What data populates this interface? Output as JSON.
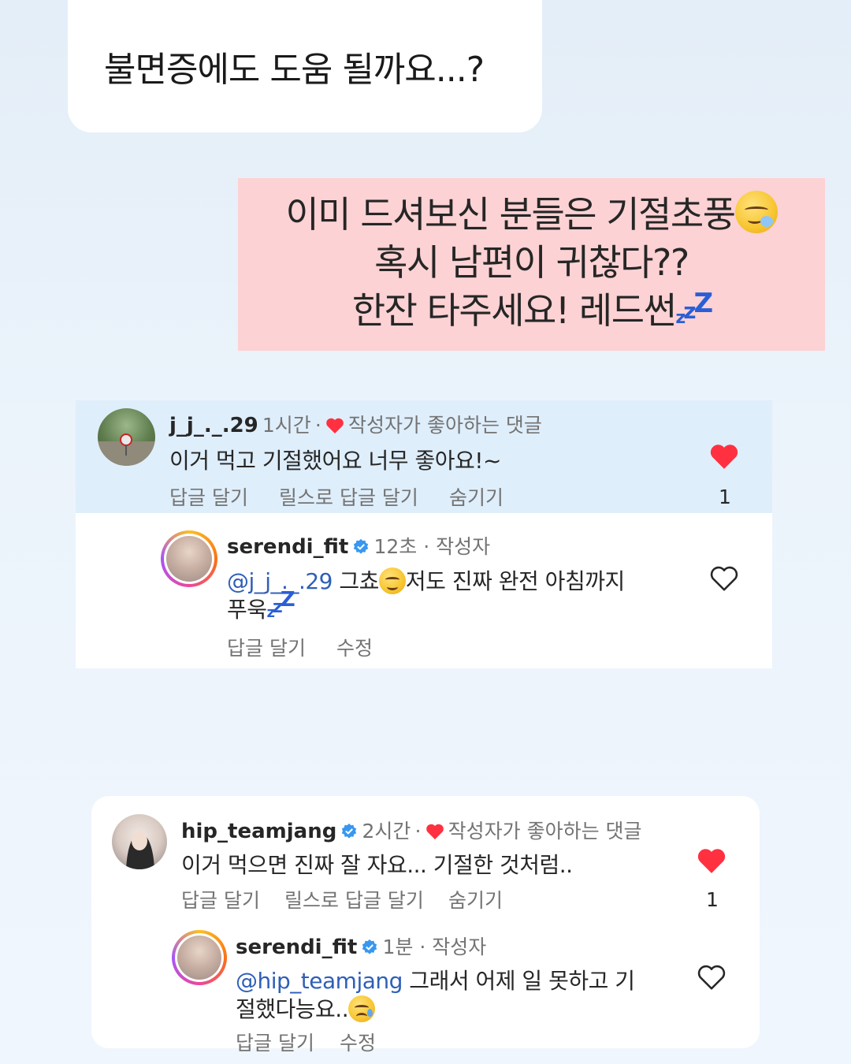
{
  "question": {
    "text": "불면증에도 도움 될까요...?"
  },
  "answer": {
    "line1": "이미 드셔보신 분들은 기절초풍",
    "line1_emoji": "sleepy-face",
    "line2": "혹시 남편이 귀찮다??",
    "line3": "한잔 타주세요! 레드썬",
    "zzz": [
      "z",
      "z",
      "Z"
    ]
  },
  "comments": [
    {
      "username": "j_j_._.29",
      "time": "1시간",
      "dot": "·",
      "liked_label": "작성자가 좋아하는 댓글",
      "text": "이거 먹고 기절했어요 너무 좋아요!~",
      "actions": [
        "답글 달기",
        "릴스로 답글 달기",
        "숨기기"
      ],
      "like_count": "1",
      "liked": true,
      "reply": {
        "username": "serendi_fit",
        "verified": true,
        "time": "12초 · 작성자",
        "mention": "@j_j_._.29",
        "text_a": " 그쵸",
        "emoji": "smiling-face",
        "text_b": "저도 진짜 완전 아침까지",
        "text_line2": "푸욱",
        "zzz": [
          "z",
          "z",
          "Z"
        ],
        "actions": [
          "답글 달기",
          "수정"
        ]
      }
    },
    {
      "username": "hip_teamjang",
      "verified": true,
      "time": "2시간",
      "dot": "·",
      "liked_label": "작성자가 좋아하는 댓글",
      "text": "이거 먹으면 진짜 잘 자요... 기절한 것처럼..",
      "actions": [
        "답글 달기",
        "릴스로 답글 달기",
        "숨기기"
      ],
      "like_count": "1",
      "liked": true,
      "reply": {
        "username": "serendi_fit",
        "verified": true,
        "time": "1분 · 작성자",
        "mention": "@hip_teamjang",
        "text_a": " 그래서 어제 일 못하고 기",
        "text_line2": "절했다능요..",
        "emoji": "crying-face",
        "actions": [
          "답글 달기",
          "수정"
        ]
      }
    }
  ],
  "colors": {
    "like_red": "#ff3040",
    "verified_blue": "#3897f0",
    "mention_blue": "#2e5fb8",
    "answer_bg": "#fcd2d4",
    "zzz_blue": "#2a5fd6"
  }
}
